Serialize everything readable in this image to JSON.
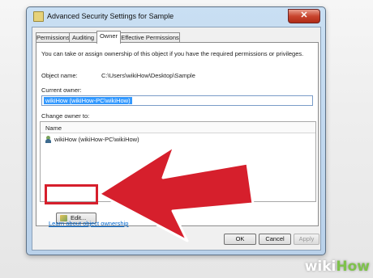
{
  "window": {
    "title": "Advanced Security Settings for Sample",
    "close_symbol": "✕"
  },
  "tabs": [
    {
      "label": "Permissions"
    },
    {
      "label": "Auditing"
    },
    {
      "label": "Owner"
    },
    {
      "label": "Effective Permissions"
    }
  ],
  "active_tab": "Owner",
  "owner_tab": {
    "description": "You can take or assign ownership of this object if you have the required permissions or privileges.",
    "object_name_label": "Object name:",
    "object_name_value": "C:\\Users\\wikiHow\\Desktop\\Sample",
    "current_owner_label": "Current owner:",
    "current_owner_value": "wikiHow (wikiHow-PC\\wikiHow)",
    "change_owner_label": "Change owner to:",
    "list_header": "Name",
    "list_items": [
      {
        "icon": "user-icon",
        "name": "wikiHow (wikiHow-PC\\wikiHow)"
      }
    ],
    "edit_button": "Edit...",
    "link": "Learn about object ownership"
  },
  "buttons": {
    "ok": "OK",
    "cancel": "Cancel",
    "apply": "Apply"
  },
  "overlay": {
    "annotation": "red-arrow",
    "highlight_color": "#d61f2c"
  },
  "watermark": {
    "prefix": "wiki",
    "suffix": "How"
  }
}
